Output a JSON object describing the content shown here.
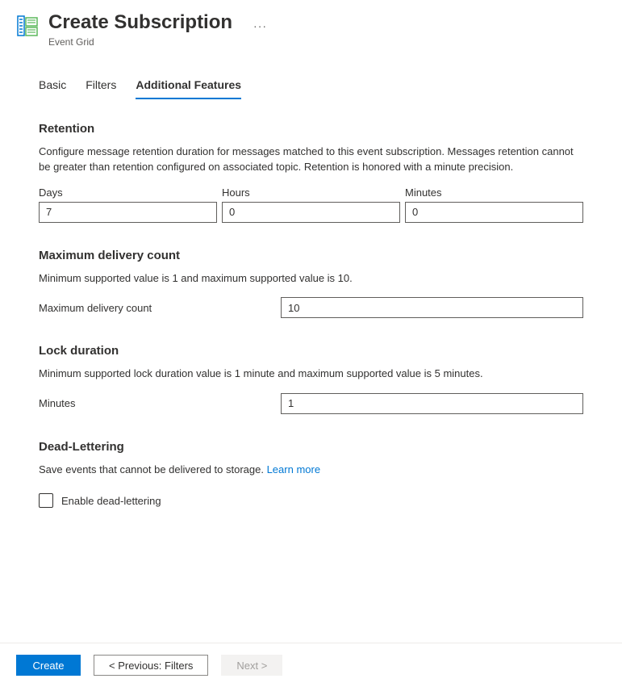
{
  "header": {
    "title": "Create Subscription",
    "subtitle": "Event Grid",
    "more": "···"
  },
  "tabs": {
    "basic": "Basic",
    "filters": "Filters",
    "additional": "Additional Features"
  },
  "retention": {
    "title": "Retention",
    "desc": "Configure message retention duration for messages matched to this event subscription. Messages retention cannot be greater than retention configured on associated topic. Retention is honored with a minute precision.",
    "days_label": "Days",
    "days_value": "7",
    "hours_label": "Hours",
    "hours_value": "0",
    "minutes_label": "Minutes",
    "minutes_value": "0"
  },
  "max_delivery": {
    "title": "Maximum delivery count",
    "desc": "Minimum supported value is 1 and maximum supported value is 10.",
    "label": "Maximum delivery count",
    "value": "10"
  },
  "lock_duration": {
    "title": "Lock duration",
    "desc": "Minimum supported lock duration value is 1 minute and maximum supported value is 5 minutes.",
    "label": "Minutes",
    "value": "1"
  },
  "dead_lettering": {
    "title": "Dead-Lettering",
    "desc_text": "Save events that cannot be delivered to storage. ",
    "learn_more": "Learn more",
    "checkbox_label": "Enable dead-lettering"
  },
  "footer": {
    "create": "Create",
    "previous": "< Previous: Filters",
    "next": "Next >"
  }
}
